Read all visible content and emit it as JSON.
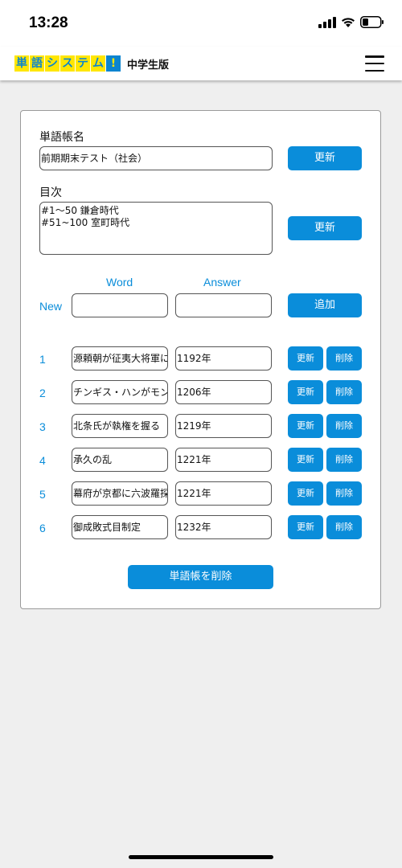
{
  "status": {
    "time": "13:28"
  },
  "header": {
    "logo_chars": [
      "単",
      "語",
      "シ",
      "ス",
      "テ",
      "ム",
      "!"
    ],
    "subtitle": "中学生版"
  },
  "book_name": {
    "label": "単語帳名",
    "value": "前期期末テスト（社会）",
    "update_label": "更新"
  },
  "toc": {
    "label": "目次",
    "value": "#1〜50 鎌倉時代\n#51~100 室町時代",
    "update_label": "更新"
  },
  "new_entry": {
    "word_header": "Word",
    "answer_header": "Answer",
    "new_label": "New",
    "word_value": "",
    "answer_value": "",
    "add_label": "追加"
  },
  "rows": [
    {
      "num": "1",
      "word": "源頼朝が征夷大将軍に",
      "answer": "1192年",
      "update": "更新",
      "delete": "削除"
    },
    {
      "num": "2",
      "word": "チンギス・ハンがモン",
      "answer": "1206年",
      "update": "更新",
      "delete": "削除"
    },
    {
      "num": "3",
      "word": "北条氏が執権を握る",
      "answer": "1219年",
      "update": "更新",
      "delete": "削除"
    },
    {
      "num": "4",
      "word": "承久の乱",
      "answer": "1221年",
      "update": "更新",
      "delete": "削除"
    },
    {
      "num": "5",
      "word": "幕府が京都に六波羅探",
      "answer": "1221年",
      "update": "更新",
      "delete": "削除"
    },
    {
      "num": "6",
      "word": "御成敗式目制定",
      "answer": "1232年",
      "update": "更新",
      "delete": "削除"
    }
  ],
  "delete_book_label": "単語帳を削除",
  "colors": {
    "accent": "#0a8dda",
    "logo_yellow": "#ffe600"
  }
}
